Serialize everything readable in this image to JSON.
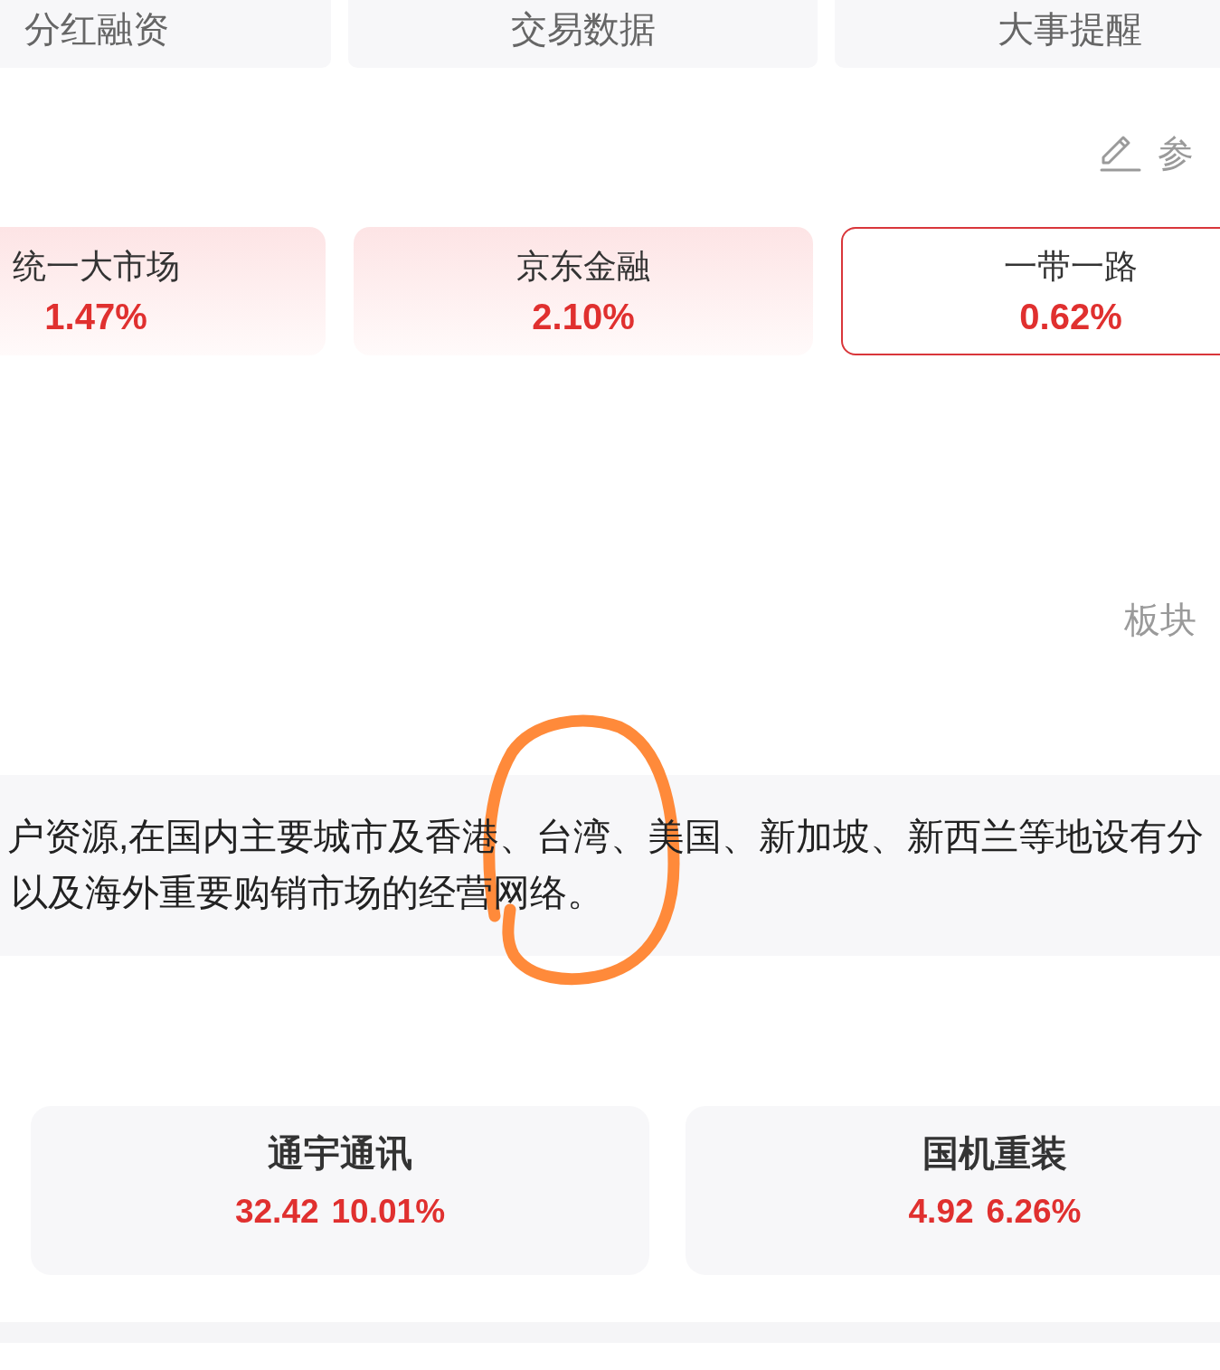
{
  "tabs": [
    {
      "label": "分红融资"
    },
    {
      "label": "交易数据"
    },
    {
      "label": "大事提醒"
    }
  ],
  "action": {
    "label": "参"
  },
  "concepts": [
    {
      "name": "统一大市场",
      "change": "1.47%",
      "selected": false
    },
    {
      "name": "京东金融",
      "change": "2.10%",
      "selected": false
    },
    {
      "name": "一带一路",
      "change": "0.62%",
      "selected": true
    }
  ],
  "sector_link": {
    "label": "板块"
  },
  "intro": {
    "lines": [
      "户资源,在国内主要城市及香港、台湾、美国、新加坡、新西兰等地设有分",
      "以及海外重要购销市场的经营网络。"
    ]
  },
  "stocks": [
    {
      "name": "通宇通讯",
      "price": "32.42",
      "change": "10.01%"
    },
    {
      "name": "国机重装",
      "price": "4.92",
      "change": "6.26%"
    }
  ],
  "annotation": {
    "kind": "circle"
  }
}
